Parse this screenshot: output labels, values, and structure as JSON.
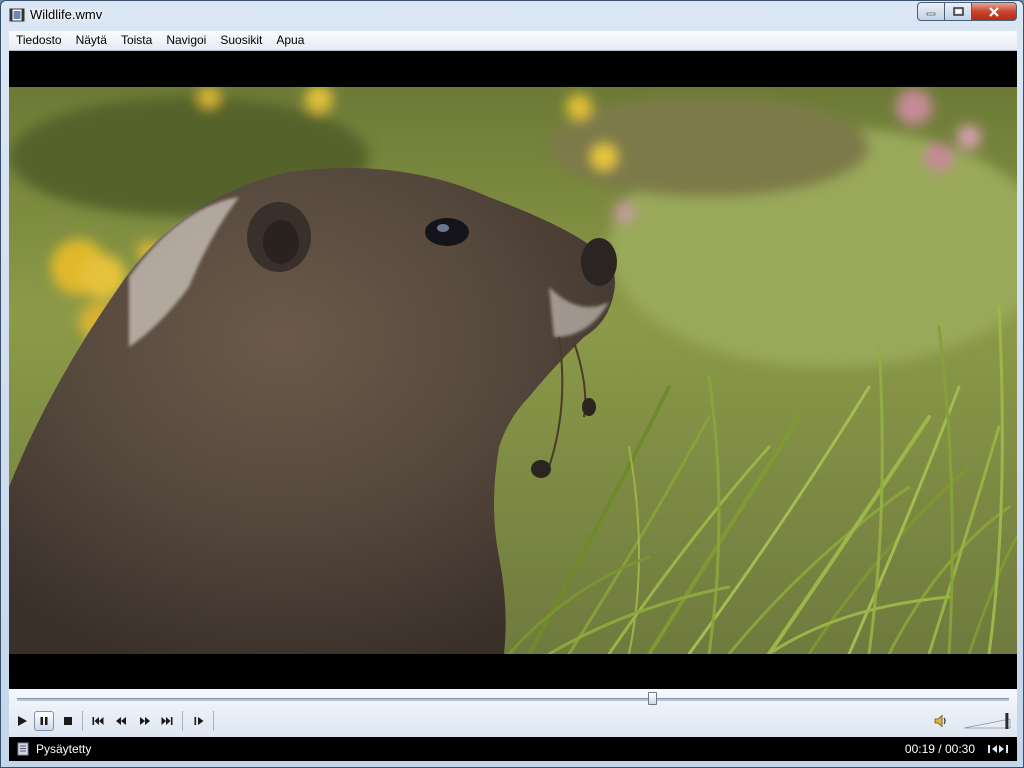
{
  "window": {
    "title": "Wildlife.wmv"
  },
  "menu": [
    "Tiedosto",
    "Näytä",
    "Toista",
    "Navigoi",
    "Suosikit",
    "Apua"
  ],
  "playback": {
    "status": "Pysäytetty",
    "position": "00:19",
    "duration": "00:30",
    "time_separator": " / ",
    "progress": 0.641,
    "volume": 0.9
  },
  "colors": {
    "accent": "#c8452c",
    "chrome": "#dbe7f4",
    "status_bg": "#000000"
  }
}
